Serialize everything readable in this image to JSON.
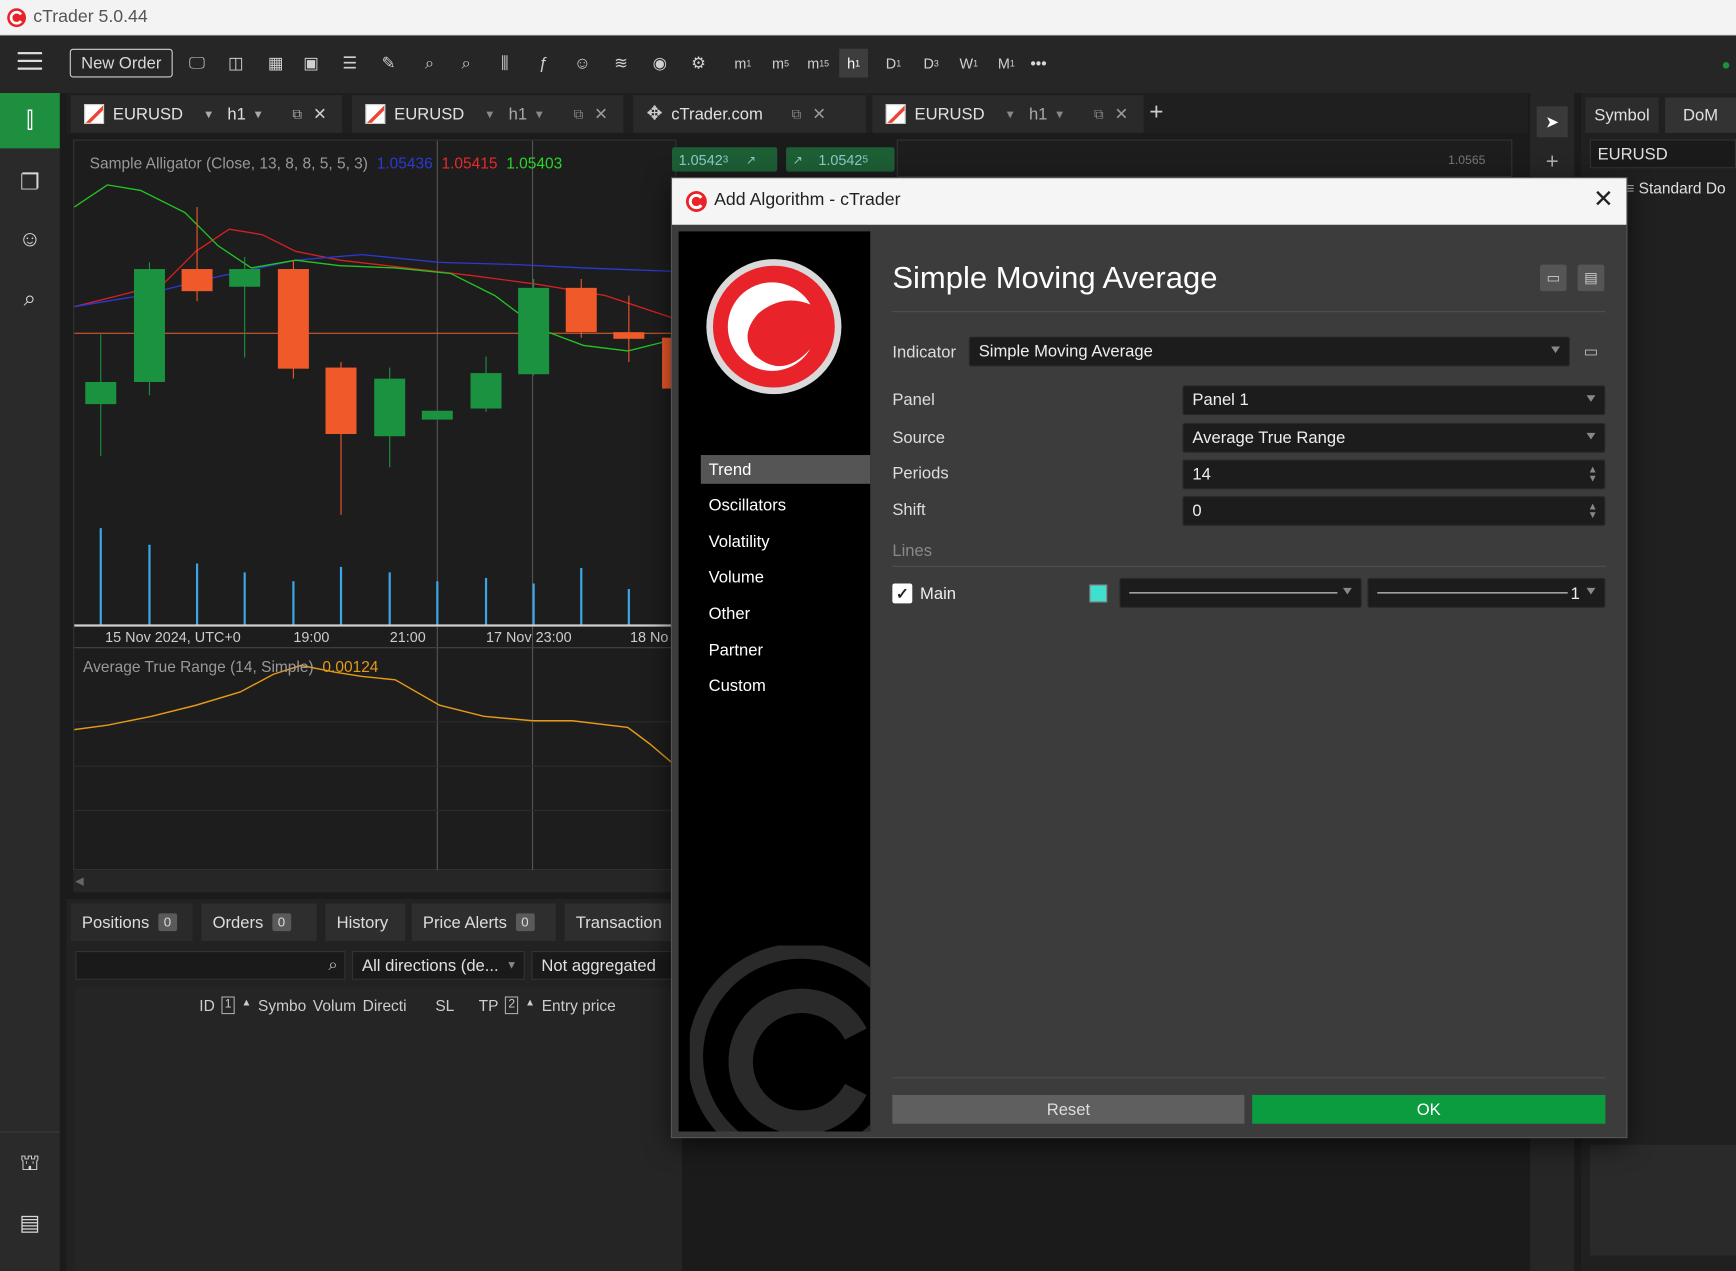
{
  "window": {
    "title": "cTrader 5.0.44"
  },
  "toolbar": {
    "new_order": "New Order",
    "timeframes": [
      "m1",
      "m5",
      "m15",
      "h1",
      "D1",
      "D3",
      "W1",
      "M1"
    ],
    "more": "•••"
  },
  "chart_tabs": [
    {
      "symbol": "EURUSD",
      "tf": "h1"
    },
    {
      "symbol": "EURUSD",
      "tf": "h1"
    },
    {
      "symbol": "cTrader.com",
      "tf": ""
    },
    {
      "symbol": "EURUSD",
      "tf": "h1"
    }
  ],
  "chart": {
    "indicator_title": "Sample Alligator (Close, 13, 8, 8, 5, 5, 3)",
    "jaw": "1.05436",
    "teeth": "1.05415",
    "lips": "1.05403",
    "sell_price": "1.0542",
    "sell_sup": "3",
    "buy_price": "1.0542",
    "buy_sup": "5",
    "time_labels": [
      "15 Nov 2024, UTC+0",
      "19:00",
      "21:00",
      "17 Nov 23:00",
      "18 No"
    ],
    "subpanel_title": "Average True Range (14, Simple)",
    "subpanel_value": "0.00124",
    "right_price": "1.0565"
  },
  "bottom": {
    "tabs": [
      {
        "label": "Positions",
        "count": "0"
      },
      {
        "label": "Orders",
        "count": "0"
      },
      {
        "label": "History",
        "count": ""
      },
      {
        "label": "Price Alerts",
        "count": "0"
      },
      {
        "label": "Transaction",
        "count": ""
      }
    ],
    "direction_filter": "All directions (de...",
    "aggregation": "Not aggregated",
    "columns": [
      "ID",
      "1",
      "Symbo",
      "Volum",
      "Directi",
      "SL",
      "TP",
      "2",
      "Entry price"
    ]
  },
  "right_panel": {
    "tabs": [
      "Symbol",
      "DoM"
    ],
    "symbol": "EURUSD",
    "list_label": "Standard Do"
  },
  "dialog": {
    "title": "Add Algorithm - cTrader",
    "heading": "Simple Moving Average",
    "categories": [
      "Trend",
      "Oscillators",
      "Volatility",
      "Volume",
      "Other",
      "Partner",
      "Custom"
    ],
    "selected_category": "Trend",
    "indicator_label": "Indicator",
    "indicator_value": "Simple Moving Average",
    "panel_label": "Panel",
    "panel_value": "Panel 1",
    "source_label": "Source",
    "source_value": "Average True Range",
    "periods_label": "Periods",
    "periods_value": "14",
    "shift_label": "Shift",
    "shift_value": "0",
    "lines_label": "Lines",
    "main_label": "Main",
    "main_checked": true,
    "line_color": "#40e0d0",
    "line_thickness": "1",
    "reset": "Reset",
    "ok": "OK"
  }
}
